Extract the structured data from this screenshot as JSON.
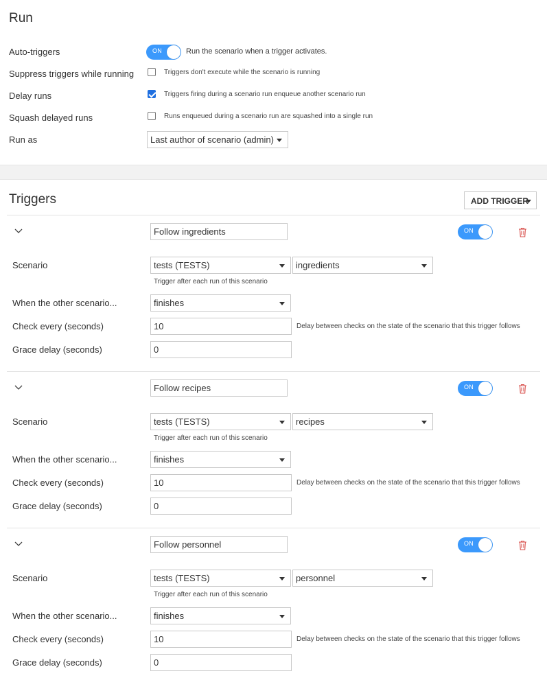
{
  "run": {
    "title": "Run",
    "auto_triggers": {
      "label": "Auto-triggers",
      "toggle": "ON",
      "desc": "Run the scenario when a trigger activates."
    },
    "suppress": {
      "label": "Suppress triggers while running",
      "checked": false,
      "desc": "Triggers don't execute while the scenario is running"
    },
    "delay": {
      "label": "Delay runs",
      "checked": true,
      "desc": "Triggers firing during a scenario run enqueue another scenario run"
    },
    "squash": {
      "label": "Squash delayed runs",
      "checked": false,
      "desc": "Runs enqueued during a scenario run are squashed into a single run"
    },
    "run_as": {
      "label": "Run as",
      "value": "Last author of scenario (admin)"
    }
  },
  "triggers": {
    "title": "Triggers",
    "add_button": "ADD TRIGGER",
    "labels": {
      "scenario": "Scenario",
      "scenario_help": "Trigger after each run of this scenario",
      "when": "When the other scenario...",
      "check_every": "Check every (seconds)",
      "check_every_help": "Delay between checks on the state of the scenario that this trigger follows",
      "grace": "Grace delay (seconds)"
    },
    "items": [
      {
        "name": "Follow ingredients",
        "toggle": "ON",
        "project": "tests (TESTS)",
        "scenario": "ingredients",
        "when": "finishes",
        "check_every": "10",
        "grace": "0"
      },
      {
        "name": "Follow recipes",
        "toggle": "ON",
        "project": "tests (TESTS)",
        "scenario": "recipes",
        "when": "finishes",
        "check_every": "10",
        "grace": "0"
      },
      {
        "name": "Follow personnel",
        "toggle": "ON",
        "project": "tests (TESTS)",
        "scenario": "personnel",
        "when": "finishes",
        "check_every": "10",
        "grace": "0"
      }
    ]
  },
  "colors": {
    "accent": "#3b99fc",
    "checkbox": "#1f6fe0",
    "delete": "#d9534f"
  },
  "icons": {
    "collapse": "chevron-down-icon",
    "delete": "trash-icon",
    "dropdown": "caret-down-icon"
  }
}
